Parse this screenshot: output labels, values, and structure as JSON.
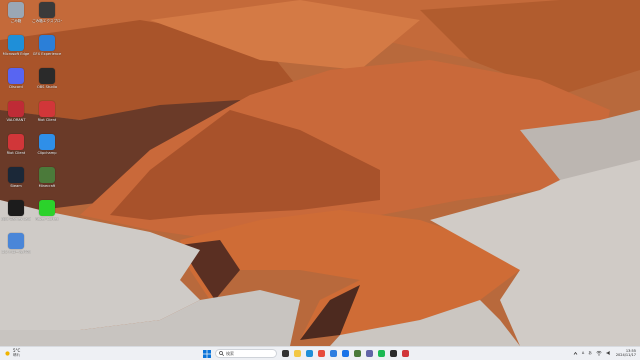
{
  "desktop_icons": [
    {
      "label": "ごみ箱",
      "icon": "recycle-bin-icon",
      "color": "#9aa7b5"
    },
    {
      "label": "ごみ箱エクスプローラー (新規)",
      "icon": "clock-icon",
      "color": "#3a3a3a"
    },
    {
      "label": "Microsoft Edge",
      "icon": "edge-icon",
      "color": "#1f8fd8"
    },
    {
      "label": "GFX Experience",
      "icon": "gfx-icon",
      "color": "#2b7fd8"
    },
    {
      "label": "Discord",
      "icon": "discord-icon",
      "color": "#5865f2"
    },
    {
      "label": "OBS Studio",
      "icon": "obs-icon",
      "color": "#2a2a2a"
    },
    {
      "label": "VALORANT",
      "icon": "valorant-icon",
      "color": "#bf2b36"
    },
    {
      "label": "Riot Client",
      "icon": "riot-icon",
      "color": "#d13639"
    },
    {
      "label": "Riot Client",
      "icon": "riot-icon",
      "color": "#d13639"
    },
    {
      "label": "Clipchamp",
      "icon": "clipchamp-icon",
      "color": "#2f8fe8"
    },
    {
      "label": "Steam",
      "icon": "steam-icon",
      "color": "#1b2838"
    },
    {
      "label": "Minecraft",
      "icon": "minecraft-icon",
      "color": "#4b7a3a"
    },
    {
      "label": "Epic Games Launcher",
      "icon": "epic-icon",
      "color": "#1c1c1c"
    },
    {
      "label": "Razer Cortex",
      "icon": "razer-icon",
      "color": "#2bd22b"
    },
    {
      "label": "コントロールパネル",
      "icon": "control-panel-icon",
      "color": "#4a86d8"
    }
  ],
  "weather": {
    "temp": "5°C",
    "condition": "晴れ"
  },
  "search": {
    "placeholder": "検索"
  },
  "taskbar_apps": [
    {
      "name": "start-button",
      "icon": "windows-icon",
      "color": "#0a74da"
    },
    {
      "name": "task-view",
      "icon": "task-view-icon",
      "color": "#333333"
    },
    {
      "name": "file-explorer",
      "icon": "folder-icon",
      "color": "#f2c744"
    },
    {
      "name": "edge",
      "icon": "edge-icon",
      "color": "#1f8fd8"
    },
    {
      "name": "chrome",
      "icon": "chrome-icon",
      "color": "#e74c3c"
    },
    {
      "name": "store",
      "icon": "store-icon",
      "color": "#2d7de0"
    },
    {
      "name": "mail",
      "icon": "mail-icon",
      "color": "#1a73e8"
    },
    {
      "name": "minecraft",
      "icon": "minecraft-icon",
      "color": "#4b7a3a"
    },
    {
      "name": "teams",
      "icon": "teams-icon",
      "color": "#6264a7"
    },
    {
      "name": "spotify",
      "icon": "spotify-icon",
      "color": "#1db954"
    },
    {
      "name": "obs",
      "icon": "obs-icon",
      "color": "#2a2a2a"
    },
    {
      "name": "riot",
      "icon": "riot-icon",
      "color": "#d13639"
    }
  ],
  "tray": {
    "lang": "A",
    "ime": "あ",
    "time": "13:55",
    "date": "2024/11/17"
  }
}
